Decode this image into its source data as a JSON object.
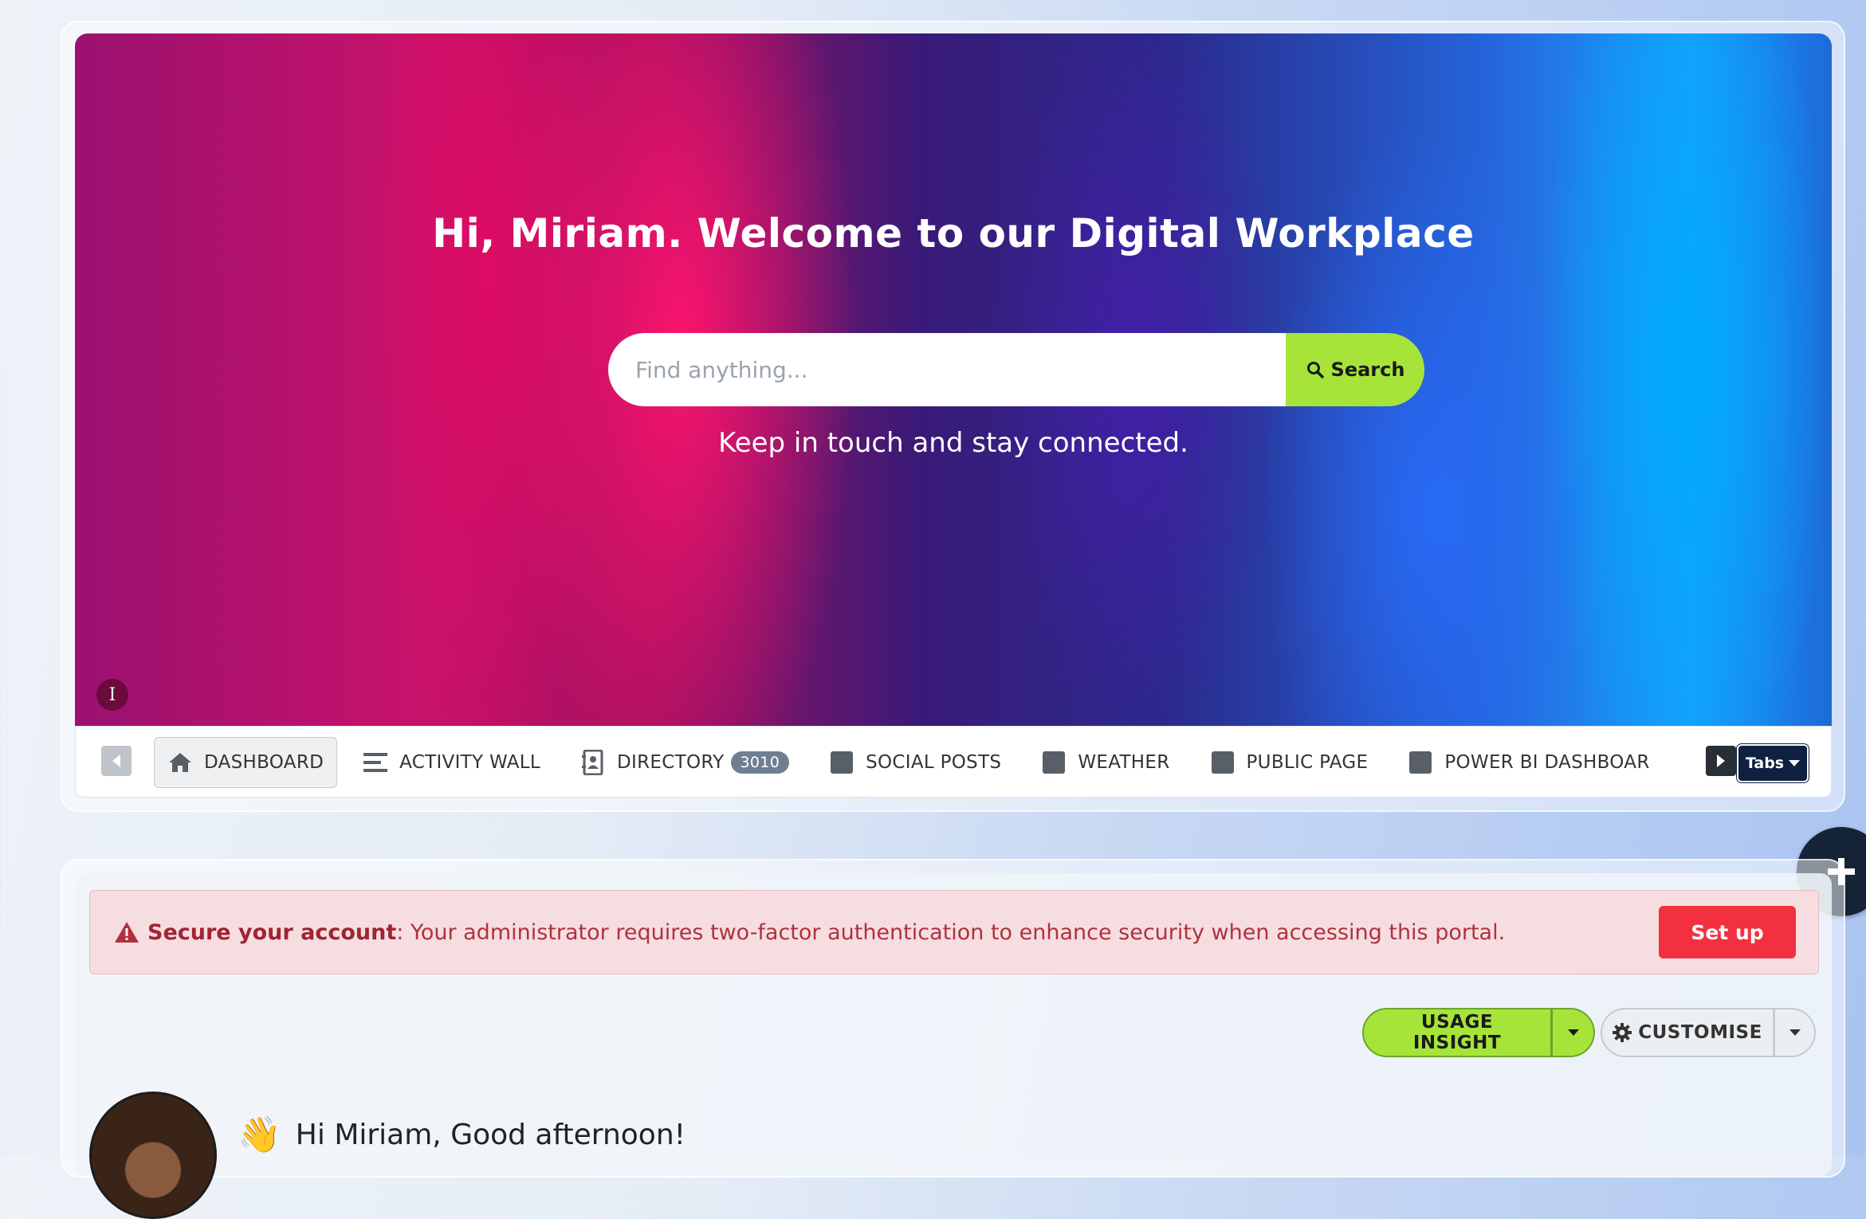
{
  "hero": {
    "title": "Hi, Miriam. Welcome to our Digital Workplace",
    "search_placeholder": "Find anything...",
    "search_button_label": "Search",
    "subtitle": "Keep in touch and stay connected.",
    "info_badge": "I"
  },
  "tabs": {
    "items": [
      {
        "label": "DASHBOARD",
        "icon": "home-icon",
        "active": true
      },
      {
        "label": "ACTIVITY WALL",
        "icon": "list-icon"
      },
      {
        "label": "DIRECTORY",
        "icon": "contacts-icon",
        "badge": "3010"
      },
      {
        "label": "SOCIAL POSTS",
        "icon": "square-icon"
      },
      {
        "label": "WEATHER",
        "icon": "square-icon"
      },
      {
        "label": "PUBLIC PAGE",
        "icon": "square-icon"
      },
      {
        "label": "POWER BI DASHBOAR",
        "icon": "square-icon"
      }
    ],
    "menu_label": "Tabs"
  },
  "alert": {
    "title": "Secure your account",
    "message": ": Your administrator requires two-factor authentication to enhance security when accessing this portal.",
    "button_label": "Set up"
  },
  "actions": {
    "usage_insight_label": "USAGE INSIGHT",
    "customise_label": "CUSTOMISE"
  },
  "greeting": {
    "text": "Hi Miriam, Good afternoon!",
    "emoji": "👋"
  },
  "colors": {
    "accent_green": "#a6e43a",
    "alert_red": "#f2303f",
    "dark_navy": "#142436"
  }
}
